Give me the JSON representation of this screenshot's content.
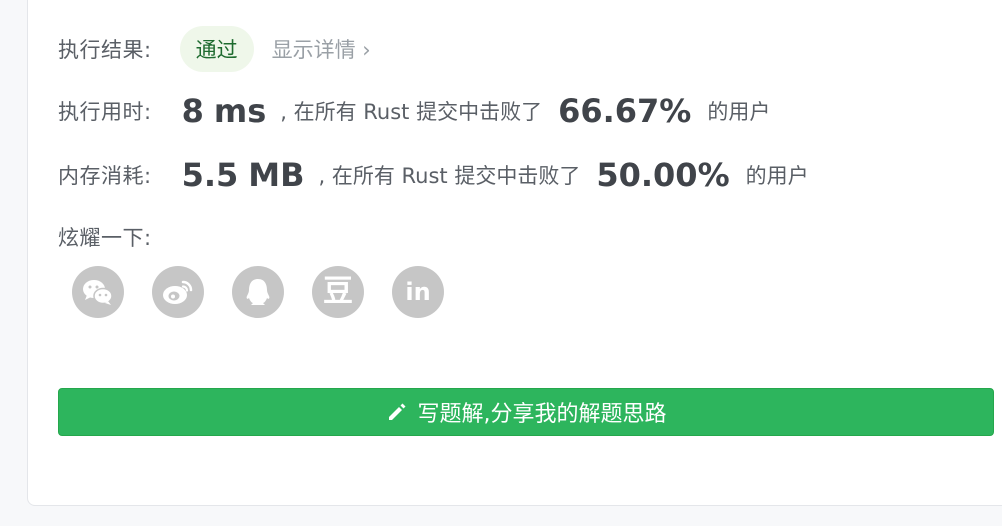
{
  "colors": {
    "success_green": "#2db55d",
    "badge_bg": "#eff7ea"
  },
  "result": {
    "label": "执行结果:",
    "status": "通过",
    "details_link": "显示详情 ›"
  },
  "runtime": {
    "label": "执行用时:",
    "value": "8",
    "unit": "ms",
    "prefix": ", 在所有 Rust 提交中击败了",
    "percent": "66.67%",
    "suffix": "的用户"
  },
  "memory": {
    "label": "内存消耗:",
    "value": "5.5",
    "unit": "MB",
    "prefix": ", 在所有 Rust 提交中击败了",
    "percent": "50.00%",
    "suffix": "的用户"
  },
  "share": {
    "label": "炫耀一下:",
    "icons": [
      "wechat-icon",
      "weibo-icon",
      "qq-icon",
      "douban-icon",
      "linkedin-icon"
    ],
    "douban_glyph": "豆",
    "linkedin_glyph": "in"
  },
  "solution_button": {
    "label": "写题解,分享我的解题思路",
    "icon": "pencil-icon"
  }
}
